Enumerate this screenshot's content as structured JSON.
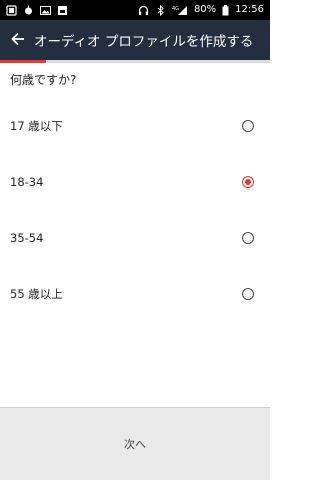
{
  "status_bar": {
    "battery": "80%",
    "time": "12:56",
    "network": "4G"
  },
  "app_bar": {
    "title": "オーディオ プロファイルを作成する"
  },
  "progress": {
    "fraction": 0.17,
    "color": "#e53935"
  },
  "question": "何歳ですか?",
  "options": [
    {
      "label": "17 歳以下",
      "selected": false
    },
    {
      "label": "18-34",
      "selected": true
    },
    {
      "label": "35-54",
      "selected": false
    },
    {
      "label": "55 歳以上",
      "selected": false
    }
  ],
  "footer": {
    "next_label": "次へ"
  },
  "colors": {
    "app_bar_bg": "#232f3e",
    "accent": "#e53935"
  }
}
